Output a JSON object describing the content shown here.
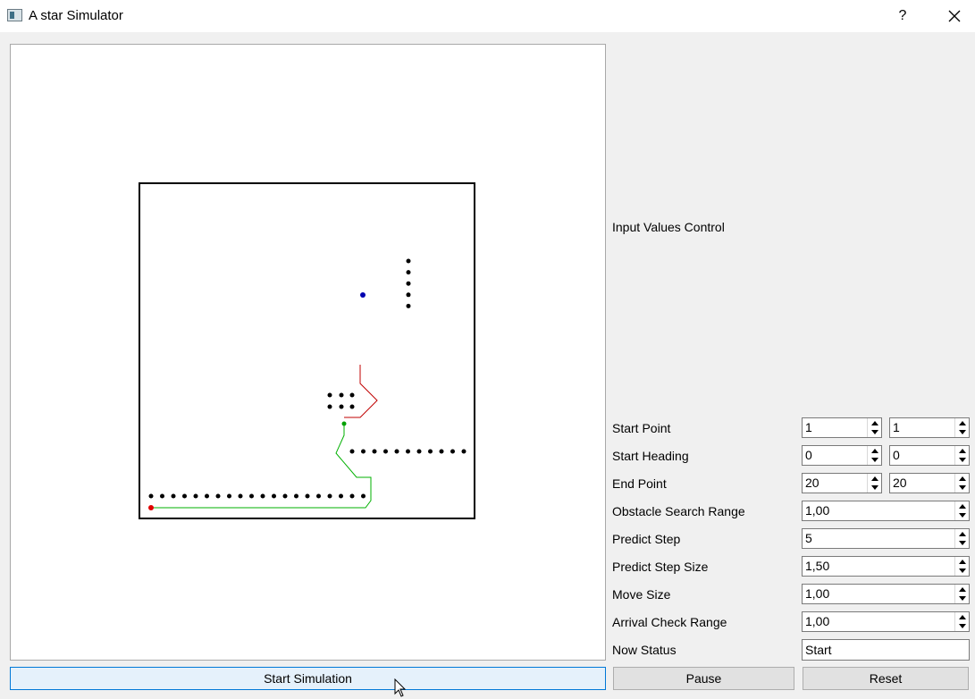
{
  "window": {
    "title": "A star Simulator",
    "help_label": "?"
  },
  "controls": {
    "heading": "Input Values Control",
    "start_point": {
      "label": "Start Point",
      "x": "1",
      "y": "1"
    },
    "start_heading": {
      "label": "Start Heading",
      "a": "0",
      "b": "0"
    },
    "end_point": {
      "label": "End Point",
      "x": "20",
      "y": "20"
    },
    "obstacle_search_range": {
      "label": "Obstacle Search Range",
      "value": "1,00"
    },
    "predict_step": {
      "label": "Predict Step",
      "value": "5"
    },
    "predict_step_size": {
      "label": "Predict Step Size",
      "value": "1,50"
    },
    "move_size": {
      "label": "Move Size",
      "value": "1,00"
    },
    "arrival_check_range": {
      "label": "Arrival Check Range",
      "value": "1,00"
    },
    "now_status": {
      "label": "Now Status",
      "value": "Start"
    }
  },
  "buttons": {
    "start_simulation": "Start Simulation",
    "pause": "Pause",
    "reset": "Reset"
  },
  "map": {
    "start_color": "#e00000",
    "goal_color": "#0000b0",
    "current_color": "#00a000",
    "traveled_path_color": "#00b000",
    "predicted_path_color": "#c00000",
    "obstacle_color": "#000000"
  }
}
